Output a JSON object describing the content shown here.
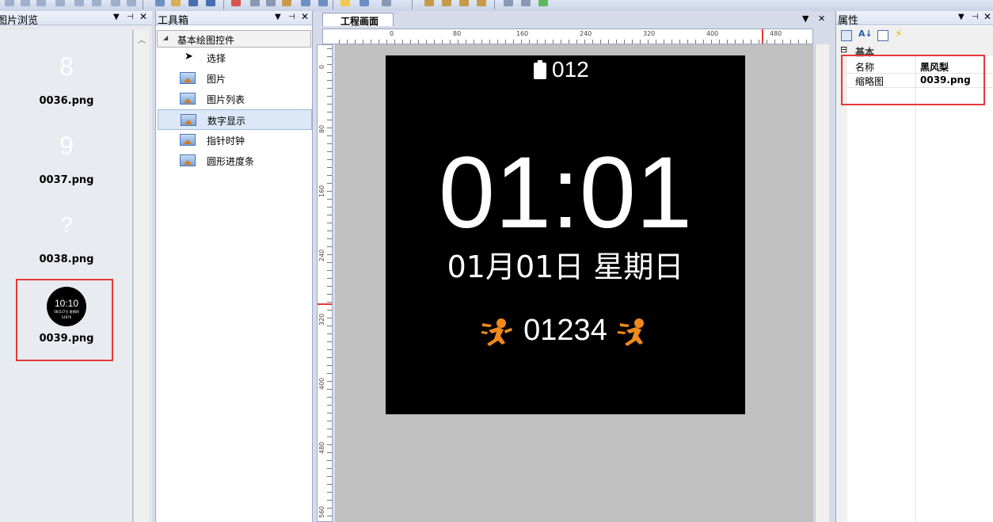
{
  "panes": {
    "image_browser": {
      "title": "图片浏览"
    },
    "toolbox": {
      "title": "工具箱"
    },
    "properties": {
      "title": "属性"
    }
  },
  "image_browser": {
    "items": [
      {
        "glyph": "8",
        "label": "0036.png"
      },
      {
        "glyph": "9",
        "label": "0037.png"
      },
      {
        "glyph": "?",
        "label": "0038.png"
      },
      {
        "label": "0039.png",
        "thumb_time": "10:10",
        "thumb_date": "08月27日 星期四",
        "thumb_steps": "14876"
      }
    ],
    "selected_index": 3
  },
  "toolbox": {
    "group_label": "基本绘图控件",
    "items": [
      {
        "label": "选择",
        "icon": "pointer-icon"
      },
      {
        "label": "图片",
        "icon": "image-icon"
      },
      {
        "label": "图片列表",
        "icon": "image-icon"
      },
      {
        "label": "数字显示",
        "icon": "image-icon",
        "selected": true
      },
      {
        "label": "指针时钟",
        "icon": "image-icon"
      },
      {
        "label": "圆形进度条",
        "icon": "image-icon"
      }
    ]
  },
  "canvas": {
    "tab_label": "工程画面",
    "ruler_h_labels": [
      "0",
      "80",
      "160",
      "240",
      "320",
      "400",
      "480"
    ],
    "ruler_v_labels": [
      "0",
      "80",
      "160",
      "240",
      "320",
      "400",
      "480",
      "560"
    ],
    "face": {
      "battery": "012",
      "time": "01:01",
      "date": "01月01日  星期日",
      "steps": "01234"
    }
  },
  "properties": {
    "category": "基本",
    "rows": [
      {
        "name": "名称",
        "value": "黑风梨"
      },
      {
        "name": "缩略图",
        "value": "0039.png"
      }
    ]
  },
  "colors": {
    "accent_red": "#e53935",
    "runner_orange": "#f08a1c",
    "face_bg": "#000000"
  }
}
